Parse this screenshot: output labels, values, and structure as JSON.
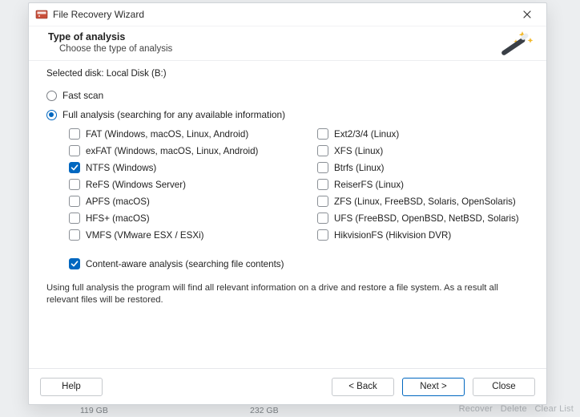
{
  "bg": {
    "hints": "Recover   Delete   Clear List",
    "size1": "119 GB",
    "size2": "232 GB"
  },
  "window": {
    "title": "File Recovery Wizard",
    "close_icon": "close-icon"
  },
  "header": {
    "title": "Type of analysis",
    "subtitle": "Choose the type of analysis",
    "wand_icon": "magic-wand-icon"
  },
  "selected_disk_label": "Selected disk: Local Disk (B:)",
  "scan_modes": {
    "fast": {
      "label": "Fast scan",
      "selected": false
    },
    "full": {
      "label": "Full analysis (searching for any available information)",
      "selected": true
    }
  },
  "fs": {
    "left": [
      {
        "key": "fat",
        "label": "FAT (Windows, macOS, Linux, Android)",
        "checked": false
      },
      {
        "key": "exfat",
        "label": "exFAT (Windows, macOS, Linux, Android)",
        "checked": false
      },
      {
        "key": "ntfs",
        "label": "NTFS (Windows)",
        "checked": true
      },
      {
        "key": "refs",
        "label": "ReFS (Windows Server)",
        "checked": false
      },
      {
        "key": "apfs",
        "label": "APFS (macOS)",
        "checked": false
      },
      {
        "key": "hfs",
        "label": "HFS+ (macOS)",
        "checked": false
      },
      {
        "key": "vmfs",
        "label": "VMFS (VMware ESX / ESXi)",
        "checked": false
      }
    ],
    "right": [
      {
        "key": "ext",
        "label": "Ext2/3/4 (Linux)",
        "checked": false
      },
      {
        "key": "xfs",
        "label": "XFS (Linux)",
        "checked": false
      },
      {
        "key": "btrfs",
        "label": "Btrfs (Linux)",
        "checked": false
      },
      {
        "key": "reiserfs",
        "label": "ReiserFS (Linux)",
        "checked": false
      },
      {
        "key": "zfs",
        "label": "ZFS (Linux, FreeBSD, Solaris, OpenSolaris)",
        "checked": false
      },
      {
        "key": "ufs",
        "label": "UFS (FreeBSD, OpenBSD, NetBSD, Solaris)",
        "checked": false
      },
      {
        "key": "hikvision",
        "label": "HikvisionFS (Hikvision DVR)",
        "checked": false
      }
    ]
  },
  "content_aware": {
    "label": "Content-aware analysis (searching file contents)",
    "checked": true
  },
  "hint": "Using full analysis the program will find all relevant information on a drive and restore a file system. As a result all relevant files will be restored.",
  "footer": {
    "help": "Help",
    "back": "< Back",
    "next": "Next >",
    "close": "Close"
  }
}
